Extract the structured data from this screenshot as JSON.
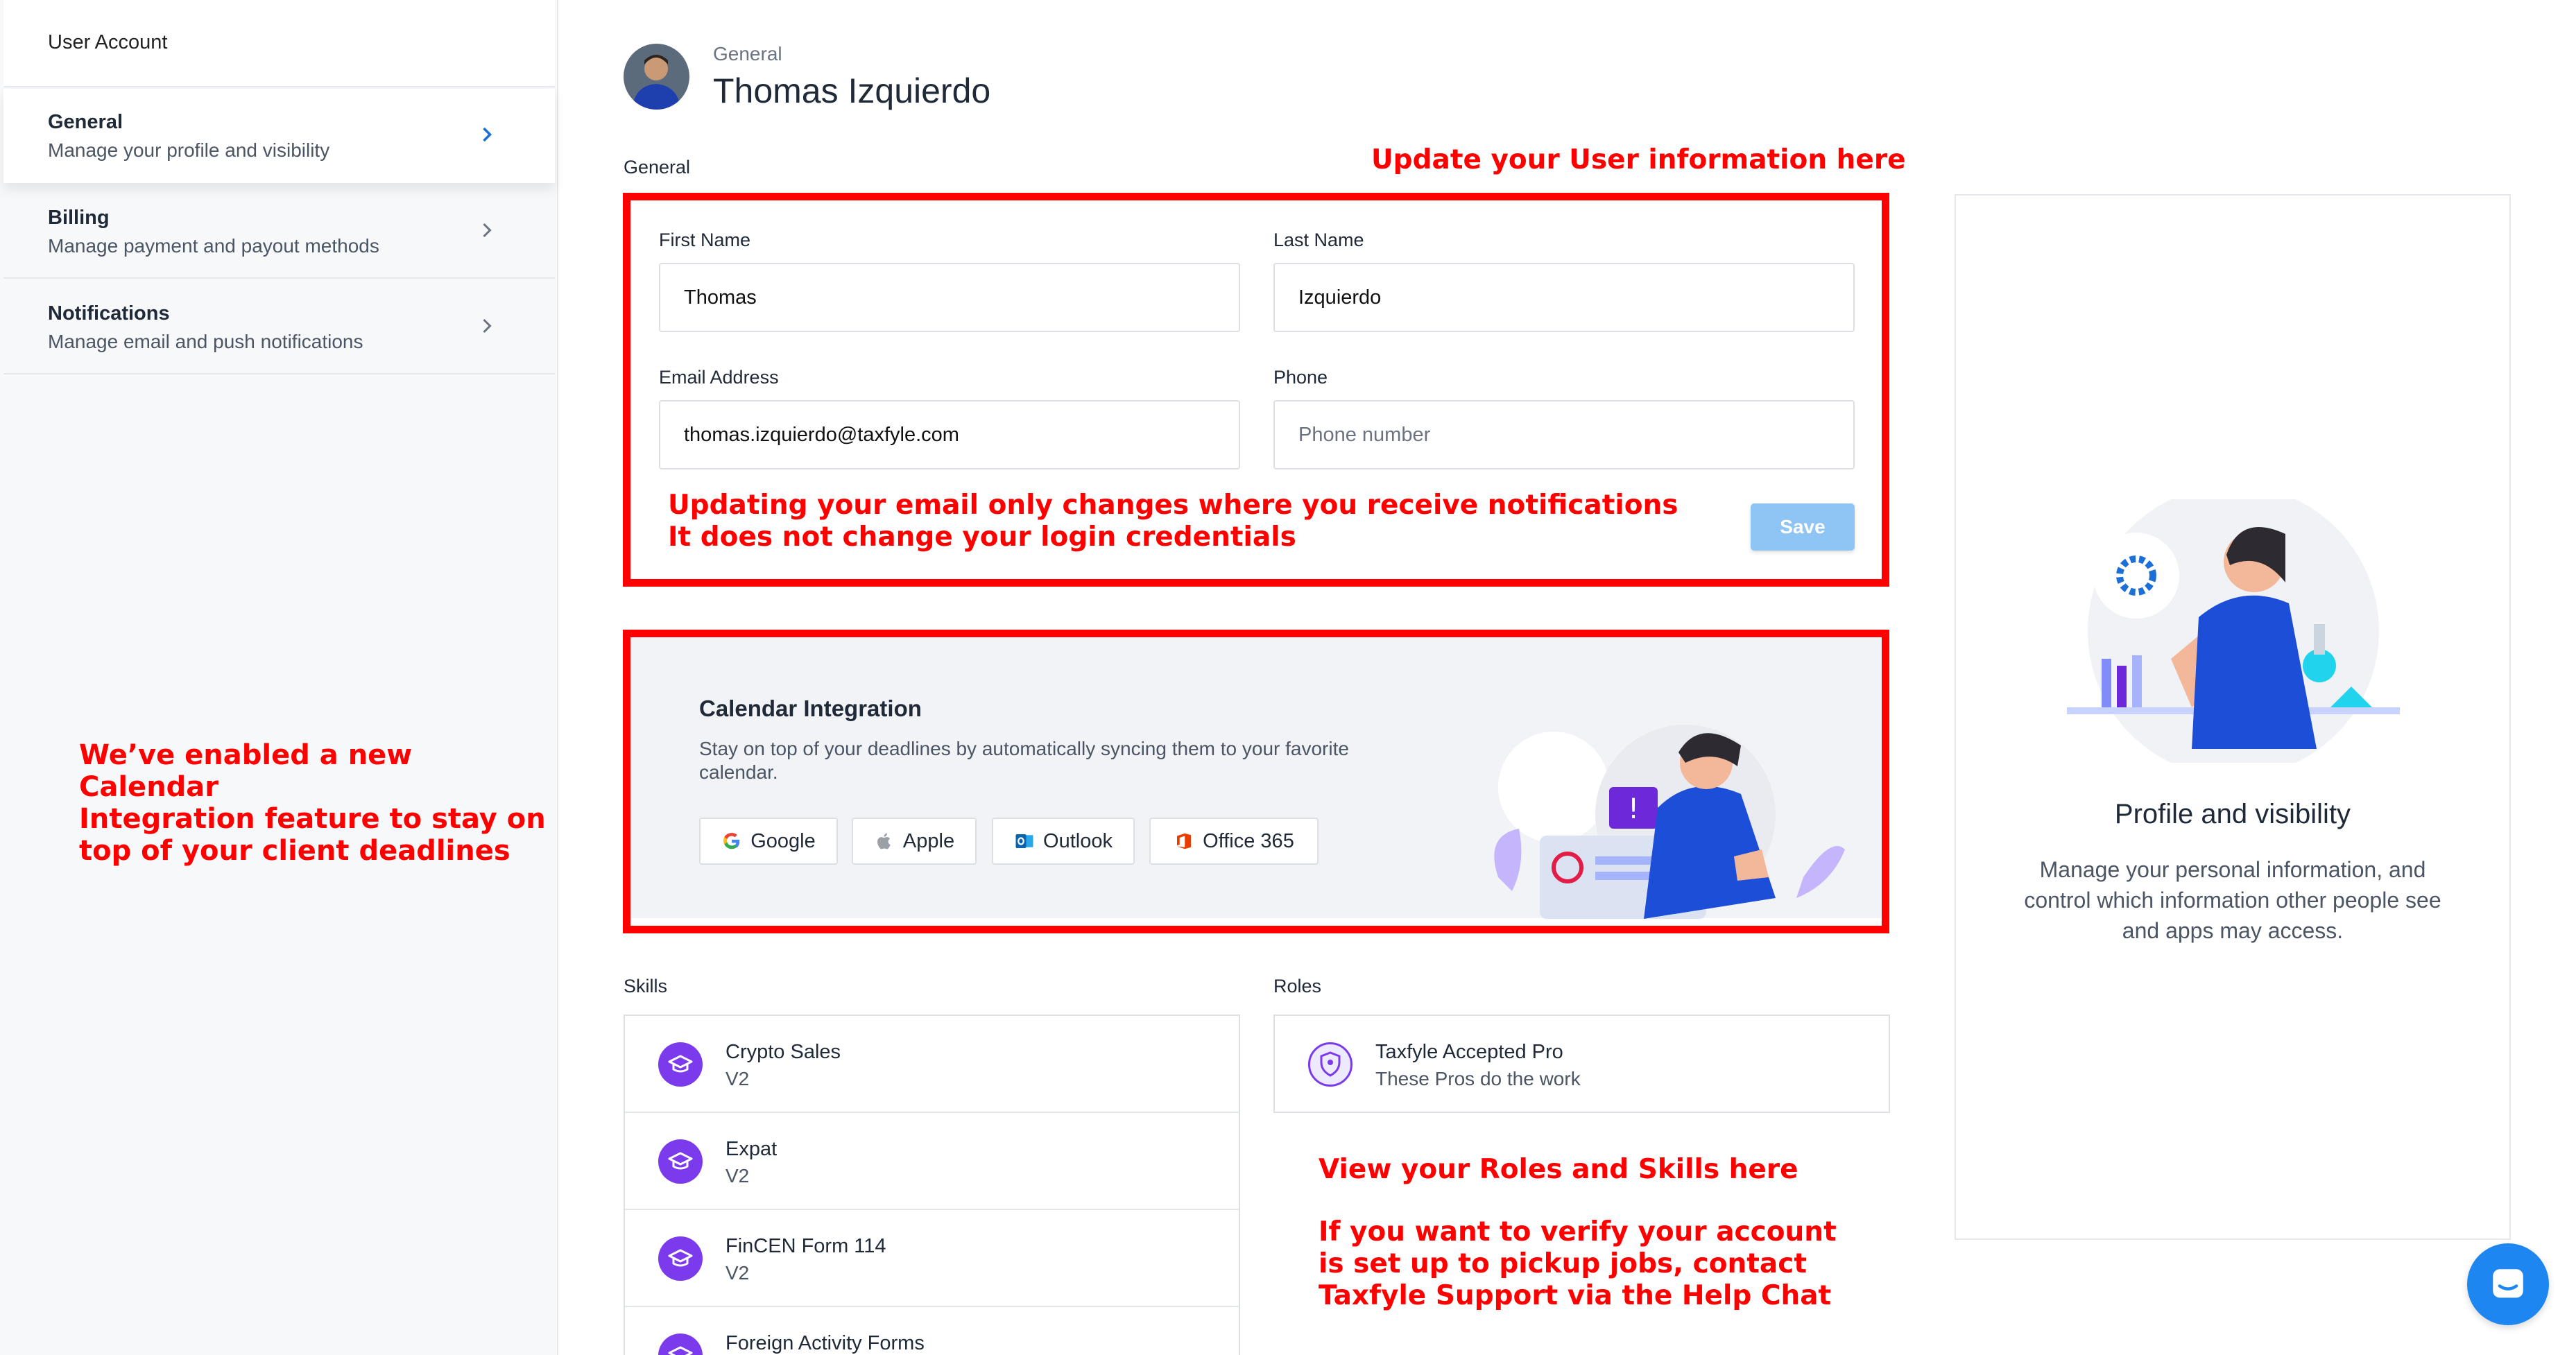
{
  "sidebar": {
    "title": "User Account",
    "items": [
      {
        "label": "General",
        "sub": "Manage your profile and visibility"
      },
      {
        "label": "Billing",
        "sub": "Manage payment and payout methods"
      },
      {
        "label": "Notifications",
        "sub": "Manage email and push notifications"
      }
    ]
  },
  "header": {
    "breadcrumb": "General",
    "name": "Thomas Izquierdo"
  },
  "general_section": {
    "label": "General"
  },
  "form": {
    "first_name_label": "First Name",
    "first_name_value": "Thomas",
    "last_name_label": "Last Name",
    "last_name_value": "Izquierdo",
    "email_label": "Email Address",
    "email_value": "thomas.izquierdo@taxfyle.com",
    "phone_label": "Phone",
    "phone_placeholder": "Phone number",
    "save_label": "Save"
  },
  "calendar": {
    "title": "Calendar Integration",
    "description": "Stay on top of your deadlines by automatically syncing them to your favorite calendar.",
    "buttons": [
      "Google",
      "Apple",
      "Outlook",
      "Office 365"
    ]
  },
  "skills": {
    "label": "Skills",
    "items": [
      {
        "name": "Crypto Sales",
        "version": "V2"
      },
      {
        "name": "Expat",
        "version": "V2"
      },
      {
        "name": "FinCEN Form 114",
        "version": "V2"
      },
      {
        "name": "Foreign Activity Forms",
        "version": ""
      }
    ]
  },
  "roles": {
    "label": "Roles",
    "items": [
      {
        "name": "Taxfyle Accepted Pro",
        "desc": "These Pros do the work"
      }
    ]
  },
  "info_card": {
    "title": "Profile and visibility",
    "description": "Manage your personal information, and control which information other people see and apps may access."
  },
  "annotations": {
    "update_info": "Update your User information here",
    "email_note_1": "Updating your email only changes where you receive notifications",
    "email_note_2": "It does not change your login credentials",
    "calendar_note_1": "We’ve enabled a new Calendar",
    "calendar_note_2": "Integration feature to stay on",
    "calendar_note_3": "top of your client deadlines",
    "roles_note": "View your Roles and Skills here",
    "verify_note_1": "If you want to verify your account",
    "verify_note_2": "is set up to pickup jobs, contact",
    "verify_note_3": "Taxfyle Support via the Help Chat"
  },
  "colors": {
    "annotation": "#ff0000",
    "accent": "#7c3aed",
    "save": "#8ec5f5",
    "chat": "#1d86f0"
  }
}
